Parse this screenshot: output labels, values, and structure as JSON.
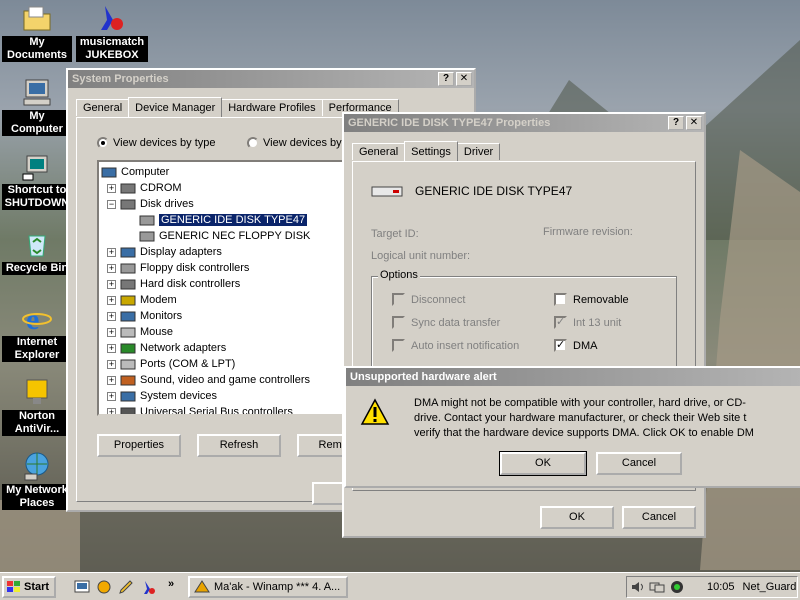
{
  "desktop": {
    "icons": [
      {
        "label": "My Documents",
        "icon": "folder-documents-icon"
      },
      {
        "label": "musicmatch JUKEBOX",
        "icon": "musicmatch-icon"
      },
      {
        "label": "My Computer",
        "icon": "computer-icon"
      },
      {
        "label": "Shortcut to SHUTDOWN",
        "icon": "shutdown-shortcut-icon"
      },
      {
        "label": "Recycle Bin",
        "icon": "recycle-bin-icon"
      },
      {
        "label": "Internet Explorer",
        "icon": "internet-explorer-icon"
      },
      {
        "label": "Norton AntiVir...",
        "icon": "norton-antivirus-icon"
      },
      {
        "label": "My Network Places",
        "icon": "network-places-icon"
      }
    ]
  },
  "system_properties": {
    "title": "System Properties",
    "tabs": [
      "General",
      "Device Manager",
      "Hardware Profiles",
      "Performance"
    ],
    "selected_tab": "Device Manager",
    "view_by_type": "View devices by type",
    "view_by_connection": "View devices by",
    "tree": [
      {
        "label": "Computer",
        "level": 0
      },
      {
        "label": "CDROM",
        "level": 1
      },
      {
        "label": "Disk drives",
        "level": 1
      },
      {
        "label": "GENERIC IDE  DISK TYPE47",
        "level": 2
      },
      {
        "label": "GENERIC NEC  FLOPPY DISK",
        "level": 2
      },
      {
        "label": "Display adapters",
        "level": 1
      },
      {
        "label": "Floppy disk controllers",
        "level": 1
      },
      {
        "label": "Hard disk controllers",
        "level": 1
      },
      {
        "label": "Modem",
        "level": 1
      },
      {
        "label": "Monitors",
        "level": 1
      },
      {
        "label": "Mouse",
        "level": 1
      },
      {
        "label": "Network adapters",
        "level": 1
      },
      {
        "label": "Ports (COM & LPT)",
        "level": 1
      },
      {
        "label": "Sound, video and game controllers",
        "level": 1
      },
      {
        "label": "System devices",
        "level": 1
      },
      {
        "label": "Universal Serial Bus controllers",
        "level": 1
      }
    ],
    "buttons": {
      "properties": "Properties",
      "refresh": "Refresh",
      "remove": "Remove"
    }
  },
  "disk_properties": {
    "title": "GENERIC IDE  DISK TYPE47 Properties",
    "tabs": [
      "General",
      "Settings",
      "Driver"
    ],
    "selected_tab": "Settings",
    "device_name": "GENERIC IDE  DISK TYPE47",
    "target_id": "Target ID:",
    "firmware": "Firmware revision:",
    "logical_unit": "Logical unit number:",
    "options_label": "Options",
    "options": {
      "disconnect": "Disconnect",
      "removable": "Removable",
      "sync": "Sync data transfer",
      "int13": "Int 13 unit",
      "auto_insert": "Auto insert notification",
      "dma": "DMA"
    },
    "ok": "OK",
    "cancel": "Cancel"
  },
  "alert": {
    "title": "Unsupported hardware alert",
    "line1": "DMA might not be compatible with your controller, hard drive, or CD-",
    "line2": "drive. Contact your hardware manufacturer, or check their Web site t",
    "line3": "verify that the hardware device supports DMA. Click OK to enable DM",
    "ok": "OK",
    "cancel": "Cancel"
  },
  "taskbar": {
    "start": "Start",
    "task": "Ma'ak - Winamp *** 4. A...",
    "clock": "10:05",
    "tray_label": "Net_Guard",
    "chevron": "»"
  }
}
